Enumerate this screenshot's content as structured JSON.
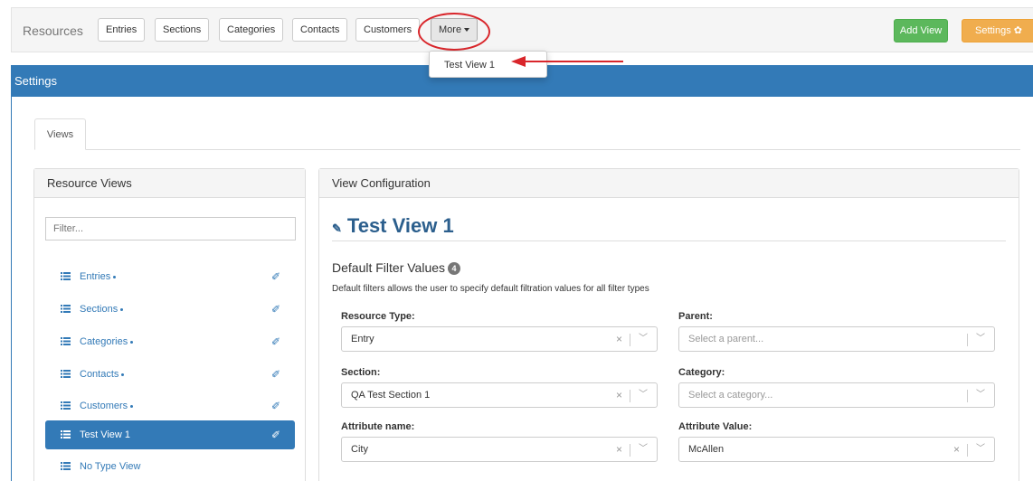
{
  "topbar": {
    "brand": "Resources",
    "tabs": [
      "Entries",
      "Sections",
      "Categories",
      "Contacts",
      "Customers"
    ],
    "more_label": "More",
    "add_view_label": "Add View",
    "settings_label": "Settings"
  },
  "more_menu": {
    "items": [
      "Test View 1"
    ]
  },
  "settings_panel": {
    "title": "Settings"
  },
  "tabs": {
    "views": "Views"
  },
  "resource_views": {
    "title": "Resource Views",
    "filter_placeholder": "Filter...",
    "items": [
      {
        "label": "Entries",
        "dot": true,
        "active": false
      },
      {
        "label": "Sections",
        "dot": true,
        "active": false
      },
      {
        "label": "Categories",
        "dot": true,
        "active": false
      },
      {
        "label": "Contacts",
        "dot": true,
        "active": false
      },
      {
        "label": "Customers",
        "dot": true,
        "active": false
      },
      {
        "label": "Test View 1",
        "dot": false,
        "active": true
      },
      {
        "label": "No Type View",
        "dot": false,
        "active": false
      }
    ]
  },
  "view_config": {
    "title": "View Configuration",
    "view_name": "Test View 1",
    "filters_heading": "Default Filter Values",
    "filters_count": "4",
    "filters_desc": "Default filters allows the user to specify default filtration values for all filter types",
    "resource_type": {
      "label": "Resource Type:",
      "value": "Entry"
    },
    "parent": {
      "label": "Parent:",
      "placeholder": "Select a parent..."
    },
    "section": {
      "label": "Section:",
      "value": "QA Test Section 1"
    },
    "category": {
      "label": "Category:",
      "placeholder": "Select a category..."
    },
    "attribute_name": {
      "label": "Attribute name:",
      "value": "City"
    },
    "attribute_value": {
      "label": "Attribute Value:",
      "value": "McAllen"
    }
  },
  "colors": {
    "primary": "#337ab7",
    "success": "#5cb85c",
    "warning": "#f0ad4e",
    "annotation": "#d9262b"
  }
}
